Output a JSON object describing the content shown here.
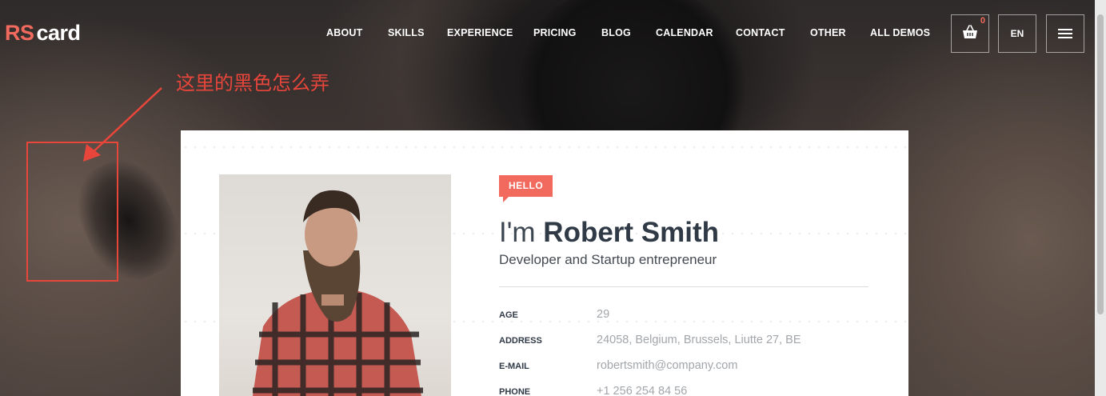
{
  "brand": {
    "logo_part1": "RS",
    "logo_part2": "card"
  },
  "nav": {
    "items": [
      "ABOUT",
      "SKILLS",
      "EXPERIENCE",
      "PRICING",
      "BLOG",
      "CALENDAR",
      "CONTACT",
      "OTHER",
      "ALL DEMOS"
    ]
  },
  "header_actions": {
    "cart_icon": "shopping-basket-icon",
    "cart_count": "0",
    "language": "EN",
    "menu_icon": "hamburger-menu-icon"
  },
  "annotation": {
    "text": "这里的黑色怎么弄",
    "color": "#e8453b"
  },
  "profile": {
    "badge": "HELLO",
    "greeting": "I'm",
    "name": "Robert Smith",
    "role": "Developer and Startup entrepreneur",
    "info": [
      {
        "label": "AGE",
        "value": "29"
      },
      {
        "label": "ADDRESS",
        "value": "24058, Belgium, Brussels, Liutte 27, BE"
      },
      {
        "label": "E-MAIL",
        "value": "robertsmith@company.com"
      },
      {
        "label": "PHONE",
        "value": "+1 256 254 84 56"
      }
    ]
  },
  "colors": {
    "accent": "#f16a5d",
    "heading": "#2f3a46",
    "muted": "#a2a6aa"
  }
}
